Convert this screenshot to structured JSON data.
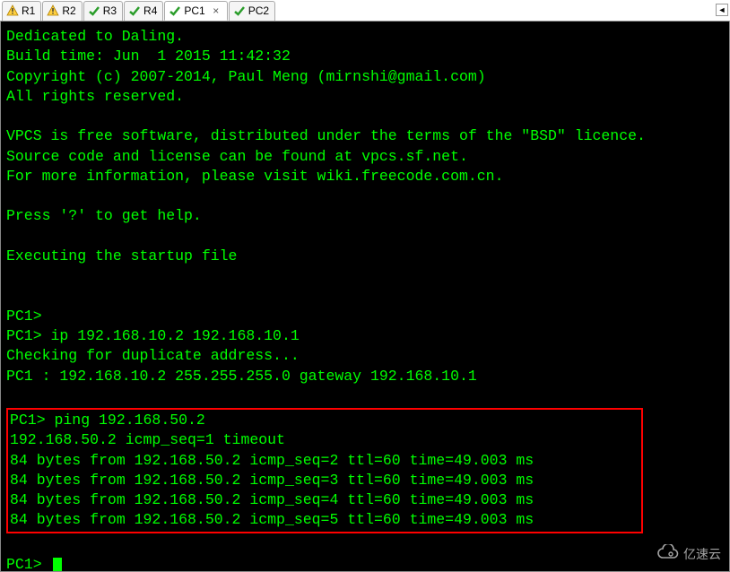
{
  "tabs": [
    {
      "label": "R1",
      "icon": "warn",
      "active": false
    },
    {
      "label": "R2",
      "icon": "warn",
      "active": false
    },
    {
      "label": "R3",
      "icon": "check",
      "active": false
    },
    {
      "label": "R4",
      "icon": "check",
      "active": false
    },
    {
      "label": "PC1",
      "icon": "check",
      "active": true
    },
    {
      "label": "PC2",
      "icon": "check",
      "active": false
    }
  ],
  "close_glyph": "×",
  "scroll_glyph": "◄",
  "terminal": {
    "intro": [
      "Dedicated to Daling.",
      "Build time: Jun  1 2015 11:42:32",
      "Copyright (c) 2007-2014, Paul Meng (mirnshi@gmail.com)",
      "All rights reserved.",
      "",
      "VPCS is free software, distributed under the terms of the \"BSD\" licence.",
      "Source code and license can be found at vpcs.sf.net.",
      "For more information, please visit wiki.freecode.com.cn.",
      "",
      "Press '?' to get help.",
      "",
      "Executing the startup file",
      "",
      "",
      "PC1>",
      "PC1> ip 192.168.10.2 192.168.10.1",
      "Checking for duplicate address...",
      "PC1 : 192.168.10.2 255.255.255.0 gateway 192.168.10.1",
      ""
    ],
    "highlighted": [
      "PC1> ping 192.168.50.2",
      "192.168.50.2 icmp_seq=1 timeout",
      "84 bytes from 192.168.50.2 icmp_seq=2 ttl=60 time=49.003 ms",
      "84 bytes from 192.168.50.2 icmp_seq=3 ttl=60 time=49.003 ms",
      "84 bytes from 192.168.50.2 icmp_seq=4 ttl=60 time=49.003 ms",
      "84 bytes from 192.168.50.2 icmp_seq=5 ttl=60 time=49.003 ms"
    ],
    "after": [
      ""
    ],
    "prompt": "PC1> "
  },
  "watermark": {
    "text": "亿速云"
  }
}
